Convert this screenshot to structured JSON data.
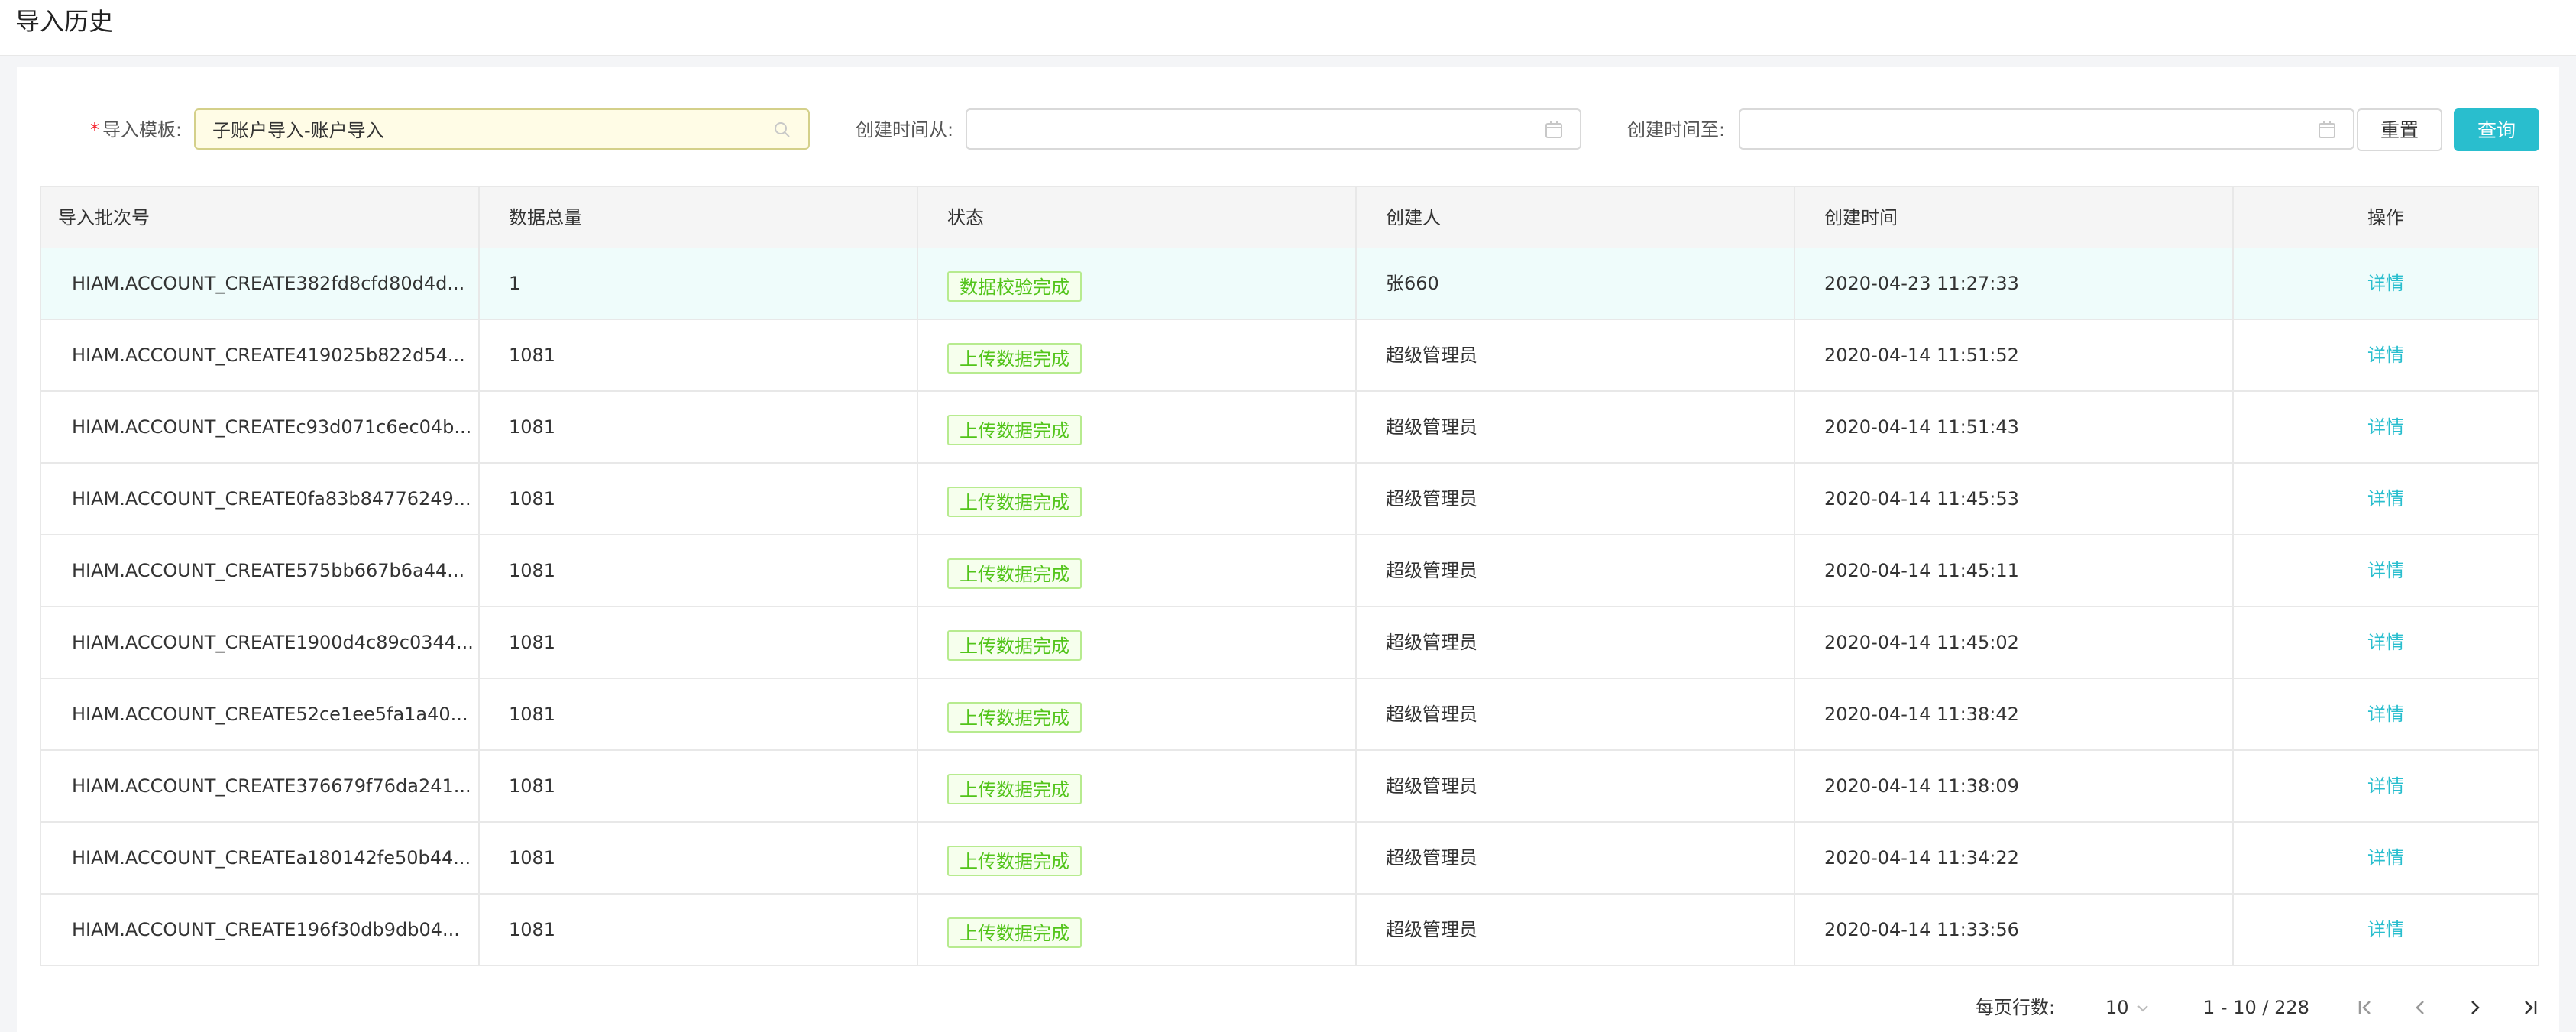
{
  "page": {
    "title": "导入历史"
  },
  "filters": {
    "template_label": "导入模板",
    "template_value": "子账户导入-账户导入",
    "created_from_label": "创建时间从",
    "created_to_label": "创建时间至",
    "colon": ":",
    "required_mark": "*"
  },
  "buttons": {
    "reset": "重置",
    "query": "查询"
  },
  "table": {
    "columns": [
      "导入批次号",
      "数据总量",
      "状态",
      "创建人",
      "创建时间",
      "操作"
    ],
    "rows": [
      {
        "batch": "HIAM.ACCOUNT_CREATE382fd8cfd80d4d...",
        "count": "1",
        "status": "数据校验完成",
        "creator": "张660",
        "time": "2020-04-23 11:27:33",
        "action": "详情"
      },
      {
        "batch": "HIAM.ACCOUNT_CREATE419025b822d54...",
        "count": "1081",
        "status": "上传数据完成",
        "creator": "超级管理员",
        "time": "2020-04-14 11:51:52",
        "action": "详情"
      },
      {
        "batch": "HIAM.ACCOUNT_CREATEc93d071c6ec04b...",
        "count": "1081",
        "status": "上传数据完成",
        "creator": "超级管理员",
        "time": "2020-04-14 11:51:43",
        "action": "详情"
      },
      {
        "batch": "HIAM.ACCOUNT_CREATE0fa83b84776249...",
        "count": "1081",
        "status": "上传数据完成",
        "creator": "超级管理员",
        "time": "2020-04-14 11:45:53",
        "action": "详情"
      },
      {
        "batch": "HIAM.ACCOUNT_CREATE575bb667b6a44...",
        "count": "1081",
        "status": "上传数据完成",
        "creator": "超级管理员",
        "time": "2020-04-14 11:45:11",
        "action": "详情"
      },
      {
        "batch": "HIAM.ACCOUNT_CREATE1900d4c89c0344...",
        "count": "1081",
        "status": "上传数据完成",
        "creator": "超级管理员",
        "time": "2020-04-14 11:45:02",
        "action": "详情"
      },
      {
        "batch": "HIAM.ACCOUNT_CREATE52ce1ee5fa1a40...",
        "count": "1081",
        "status": "上传数据完成",
        "creator": "超级管理员",
        "time": "2020-04-14 11:38:42",
        "action": "详情"
      },
      {
        "batch": "HIAM.ACCOUNT_CREATE376679f76da241...",
        "count": "1081",
        "status": "上传数据完成",
        "creator": "超级管理员",
        "time": "2020-04-14 11:38:09",
        "action": "详情"
      },
      {
        "batch": "HIAM.ACCOUNT_CREATEa180142fe50b44...",
        "count": "1081",
        "status": "上传数据完成",
        "creator": "超级管理员",
        "time": "2020-04-14 11:34:22",
        "action": "详情"
      },
      {
        "batch": "HIAM.ACCOUNT_CREATE196f30db9db04...",
        "count": "1081",
        "status": "上传数据完成",
        "creator": "超级管理员",
        "time": "2020-04-14 11:33:56",
        "action": "详情"
      }
    ]
  },
  "pagination": {
    "rows_per_page_label": "每页行数:",
    "rows_per_page_value": "10",
    "range": "1 - 10 / 228"
  },
  "colors": {
    "accent": "#29bece",
    "success_text": "#52c41a",
    "selected_row": "#effcfb"
  },
  "icons": [
    "search-icon",
    "calendar-icon",
    "chevron-down-icon",
    "first-page-icon",
    "prev-page-icon",
    "next-page-icon",
    "last-page-icon"
  ]
}
